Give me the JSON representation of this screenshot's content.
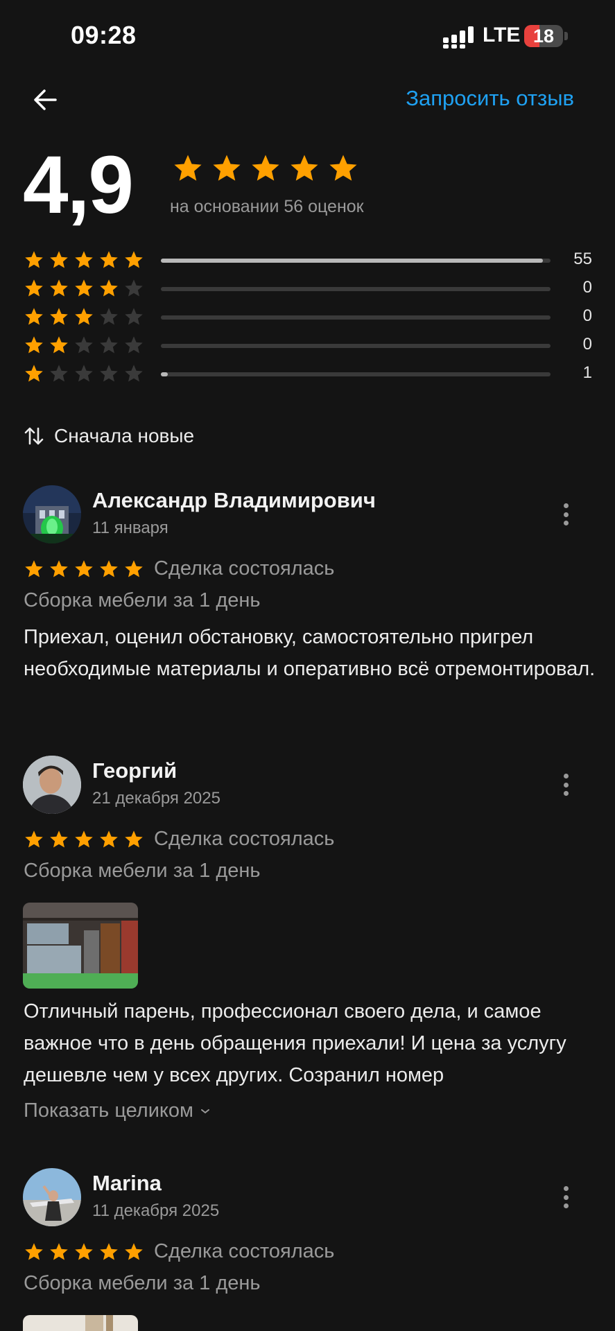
{
  "status_bar": {
    "time": "09:28",
    "network": "LTE",
    "battery": "18",
    "battery_fraction": 0.18,
    "icons": [
      "signal-icon",
      "battery-icon"
    ]
  },
  "header": {
    "back_icon": "arrow-left-icon",
    "request_review_label": "Запросить отзыв"
  },
  "summary": {
    "rating": "4,9",
    "stars": 5,
    "basis": "на основании 56 оценок",
    "distribution": [
      {
        "stars": 5,
        "count": "55",
        "fraction": 0.98
      },
      {
        "stars": 4,
        "count": "0",
        "fraction": 0
      },
      {
        "stars": 3,
        "count": "0",
        "fraction": 0
      },
      {
        "stars": 2,
        "count": "0",
        "fraction": 0
      },
      {
        "stars": 1,
        "count": "1",
        "fraction": 0.018
      }
    ]
  },
  "sort": {
    "icon": "sort-arrows-icon",
    "label": "Сначала новые"
  },
  "reviews": [
    {
      "author": "Александр Владимирович",
      "date": "11 января",
      "stars": 5,
      "deal": "Сделка состоялась",
      "service": "Сборка мебели за 1 день",
      "text": "Приехал, оценил обстановку, самостоятельно пригрел необходимые материалы и оперативно всё отремонтировал."
    },
    {
      "author": "Георгий",
      "date": "21 декабря 2025",
      "stars": 5,
      "deal": "Сделка состоялась",
      "service": "Сборка мебели за 1 день",
      "text": "Отличный парень, профессионал своего дела, и самое важное что в день обращения приехали! И цена за услугу дешевле чем у всех других. Созранил номер",
      "show_more": "Показать целиком"
    },
    {
      "author": "Marina",
      "date": "11 декабря 2025",
      "stars": 5,
      "deal": "Сделка состоялась",
      "service": "Сборка мебели за 1 день"
    }
  ],
  "colors": {
    "background": "#141414",
    "accent": "#1fa1f2",
    "star_filled": "#ffa000",
    "star_empty": "#3a3a3a",
    "muted_text": "#9a9a9a"
  }
}
